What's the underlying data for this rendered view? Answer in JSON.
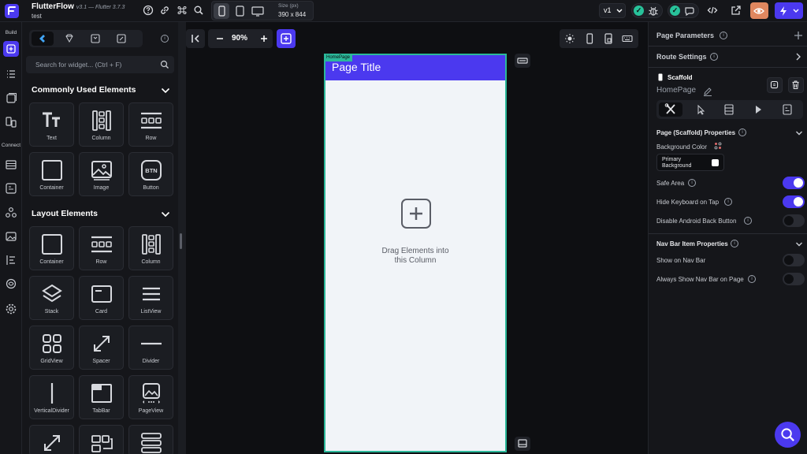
{
  "topbar": {
    "brand": "FlutterFlow",
    "brand_version": "v3.1 — Flutter 3.7.3",
    "project_name": "test",
    "size_label": "Size (px)",
    "size_value": "390 x 844",
    "version": "v1"
  },
  "rail": {
    "build_label": "Build",
    "connect_label": "Connect"
  },
  "widget_panel": {
    "search_placeholder": "Search for widget... (Ctrl + F)",
    "common_section": {
      "title": "Commonly Used Elements",
      "items": [
        "Text",
        "Column",
        "Row",
        "Container",
        "Image",
        "Button"
      ]
    },
    "layout_section": {
      "title": "Layout Elements",
      "items": [
        "Container",
        "Row",
        "Column",
        "Stack",
        "Card",
        "ListView",
        "GridView",
        "Spacer",
        "Divider",
        "VerticalDivider",
        "TabBar",
        "PageView"
      ]
    }
  },
  "canvas": {
    "zoom": "90%",
    "page_tag": "HomePage",
    "page_title": "Page Title",
    "drop_hint_line1": "Drag Elements into",
    "drop_hint_line2": "this Column",
    "colors": {
      "app_bar": "#4b39ef",
      "page_background": "#f1f4f8",
      "selection": "#2bb89a"
    }
  },
  "properties": {
    "page_parameters": "Page Parameters",
    "route_settings": "Route Settings",
    "widget_type": "Scaffold",
    "widget_name": "HomePage",
    "scaffold_section": "Page (Scaffold) Properties",
    "background_color_label": "Background Color",
    "background_color_value": "Primary Background",
    "safe_area_label": "Safe Area",
    "safe_area_on": true,
    "hide_keyboard_label": "Hide Keyboard on Tap",
    "hide_keyboard_on": true,
    "disable_back_label": "Disable Android Back Button",
    "disable_back_on": false,
    "nav_section": "Nav Bar Item Properties",
    "show_nav_label": "Show on Nav Bar",
    "show_nav_on": false,
    "always_show_nav_label": "Always Show Nav Bar on Page",
    "always_show_nav_on": false
  }
}
